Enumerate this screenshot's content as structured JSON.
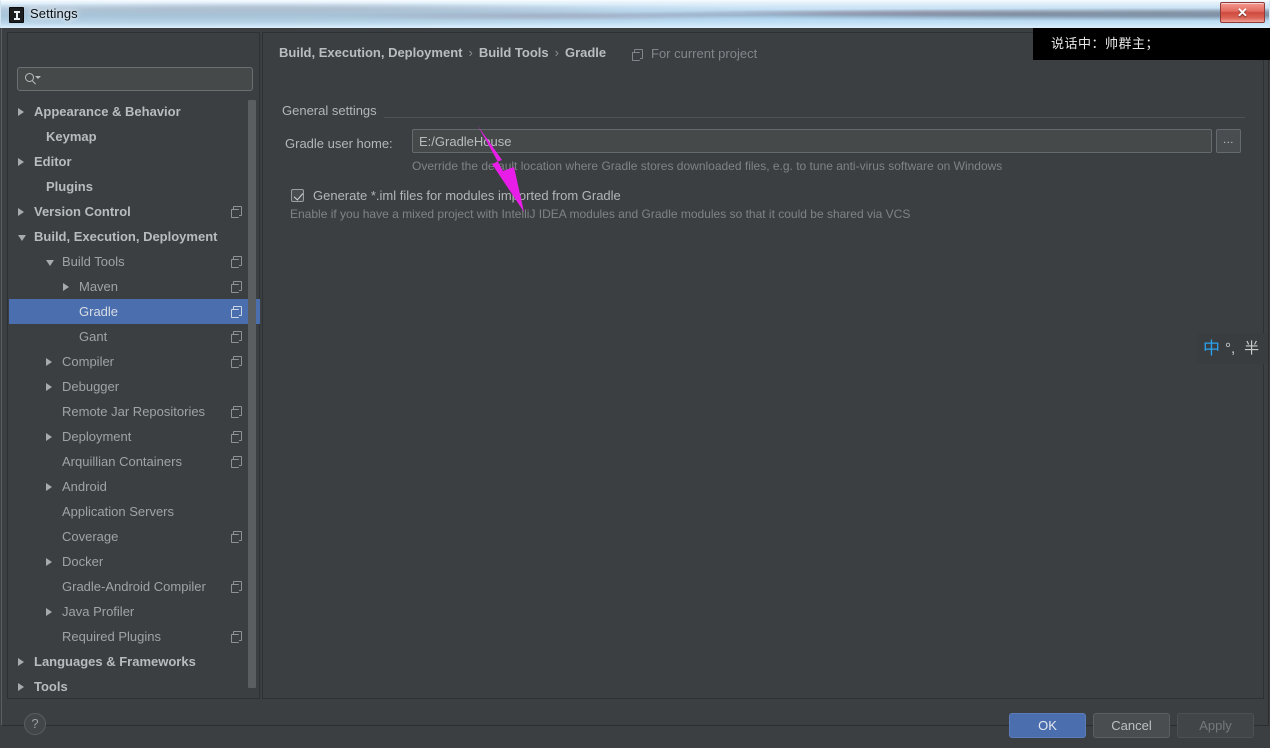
{
  "window": {
    "title": "Settings",
    "app_icon": "intellij-idea-icon",
    "close_label": "✕"
  },
  "sidebar": {
    "search": {
      "value": "",
      "placeholder": "",
      "icon": "search-icon"
    },
    "items": [
      {
        "label": "Appearance & Behavior",
        "indent": 25,
        "twisty": "collapsed",
        "bold": true,
        "copy": false,
        "selected": false
      },
      {
        "label": "Keymap",
        "indent": 37,
        "twisty": "none",
        "bold": true,
        "copy": false,
        "selected": false
      },
      {
        "label": "Editor",
        "indent": 25,
        "twisty": "collapsed",
        "bold": true,
        "copy": false,
        "selected": false
      },
      {
        "label": "Plugins",
        "indent": 37,
        "twisty": "none",
        "bold": true,
        "copy": false,
        "selected": false
      },
      {
        "label": "Version Control",
        "indent": 25,
        "twisty": "collapsed",
        "bold": true,
        "copy": true,
        "selected": false
      },
      {
        "label": "Build, Execution, Deployment",
        "indent": 25,
        "twisty": "expanded",
        "bold": true,
        "copy": false,
        "selected": false
      },
      {
        "label": "Build Tools",
        "indent": 53,
        "twisty": "expanded",
        "bold": false,
        "copy": true,
        "selected": false
      },
      {
        "label": "Maven",
        "indent": 70,
        "twisty": "collapsed",
        "bold": false,
        "copy": true,
        "selected": false
      },
      {
        "label": "Gradle",
        "indent": 70,
        "twisty": "none",
        "bold": false,
        "copy": true,
        "selected": true
      },
      {
        "label": "Gant",
        "indent": 70,
        "twisty": "none",
        "bold": false,
        "copy": true,
        "selected": false
      },
      {
        "label": "Compiler",
        "indent": 53,
        "twisty": "collapsed",
        "bold": false,
        "copy": true,
        "selected": false
      },
      {
        "label": "Debugger",
        "indent": 53,
        "twisty": "collapsed",
        "bold": false,
        "copy": false,
        "selected": false
      },
      {
        "label": "Remote Jar Repositories",
        "indent": 53,
        "twisty": "none",
        "bold": false,
        "copy": true,
        "selected": false
      },
      {
        "label": "Deployment",
        "indent": 53,
        "twisty": "collapsed",
        "bold": false,
        "copy": true,
        "selected": false
      },
      {
        "label": "Arquillian Containers",
        "indent": 53,
        "twisty": "none",
        "bold": false,
        "copy": true,
        "selected": false
      },
      {
        "label": "Android",
        "indent": 53,
        "twisty": "collapsed",
        "bold": false,
        "copy": false,
        "selected": false
      },
      {
        "label": "Application Servers",
        "indent": 53,
        "twisty": "none",
        "bold": false,
        "copy": false,
        "selected": false
      },
      {
        "label": "Coverage",
        "indent": 53,
        "twisty": "none",
        "bold": false,
        "copy": true,
        "selected": false
      },
      {
        "label": "Docker",
        "indent": 53,
        "twisty": "collapsed",
        "bold": false,
        "copy": false,
        "selected": false
      },
      {
        "label": "Gradle-Android Compiler",
        "indent": 53,
        "twisty": "none",
        "bold": false,
        "copy": true,
        "selected": false
      },
      {
        "label": "Java Profiler",
        "indent": 53,
        "twisty": "collapsed",
        "bold": false,
        "copy": false,
        "selected": false
      },
      {
        "label": "Required Plugins",
        "indent": 53,
        "twisty": "none",
        "bold": false,
        "copy": true,
        "selected": false
      },
      {
        "label": "Languages & Frameworks",
        "indent": 25,
        "twisty": "collapsed",
        "bold": true,
        "copy": false,
        "selected": false
      },
      {
        "label": "Tools",
        "indent": 25,
        "twisty": "collapsed",
        "bold": true,
        "copy": false,
        "selected": false
      }
    ]
  },
  "content": {
    "breadcrumb": {
      "part1": "Build, Execution, Deployment",
      "sep1": "›",
      "part2": "Build Tools",
      "sep2": "›",
      "part3": "Gradle"
    },
    "scope": {
      "label": "For current project",
      "icon": "copy-scope-icon"
    },
    "group_label": "General settings",
    "gradle_home": {
      "label": "Gradle user home:",
      "value": "E:/GradleHouse",
      "placeholder": "",
      "browse_label": "...",
      "hint": "Override the default location where Gradle stores downloaded files, e.g. to tune anti-virus software on Windows"
    },
    "generate_iml": {
      "checked": true,
      "label": "Generate *.iml files for modules imported from Gradle",
      "hint": "Enable if you have a mixed project with IntelliJ IDEA modules and Gradle modules so that it could be shared via VCS"
    }
  },
  "footer": {
    "help_label": "?",
    "ok_label": "OK",
    "cancel_label": "Cancel",
    "apply_label": "Apply"
  },
  "overlays": {
    "chat_tooltip": "说话中：帅群主；",
    "ime": {
      "mode": "中",
      "symbol1": "°,",
      "symbol2": "半"
    },
    "annotation_arrow": "magenta-arrow-icon"
  },
  "colors": {
    "accent": "#4b6eaf",
    "panel_bg": "#3c3f41",
    "text": "#b3b6b8",
    "hint_text": "#7f8386",
    "annotation": "#e81ee8"
  }
}
